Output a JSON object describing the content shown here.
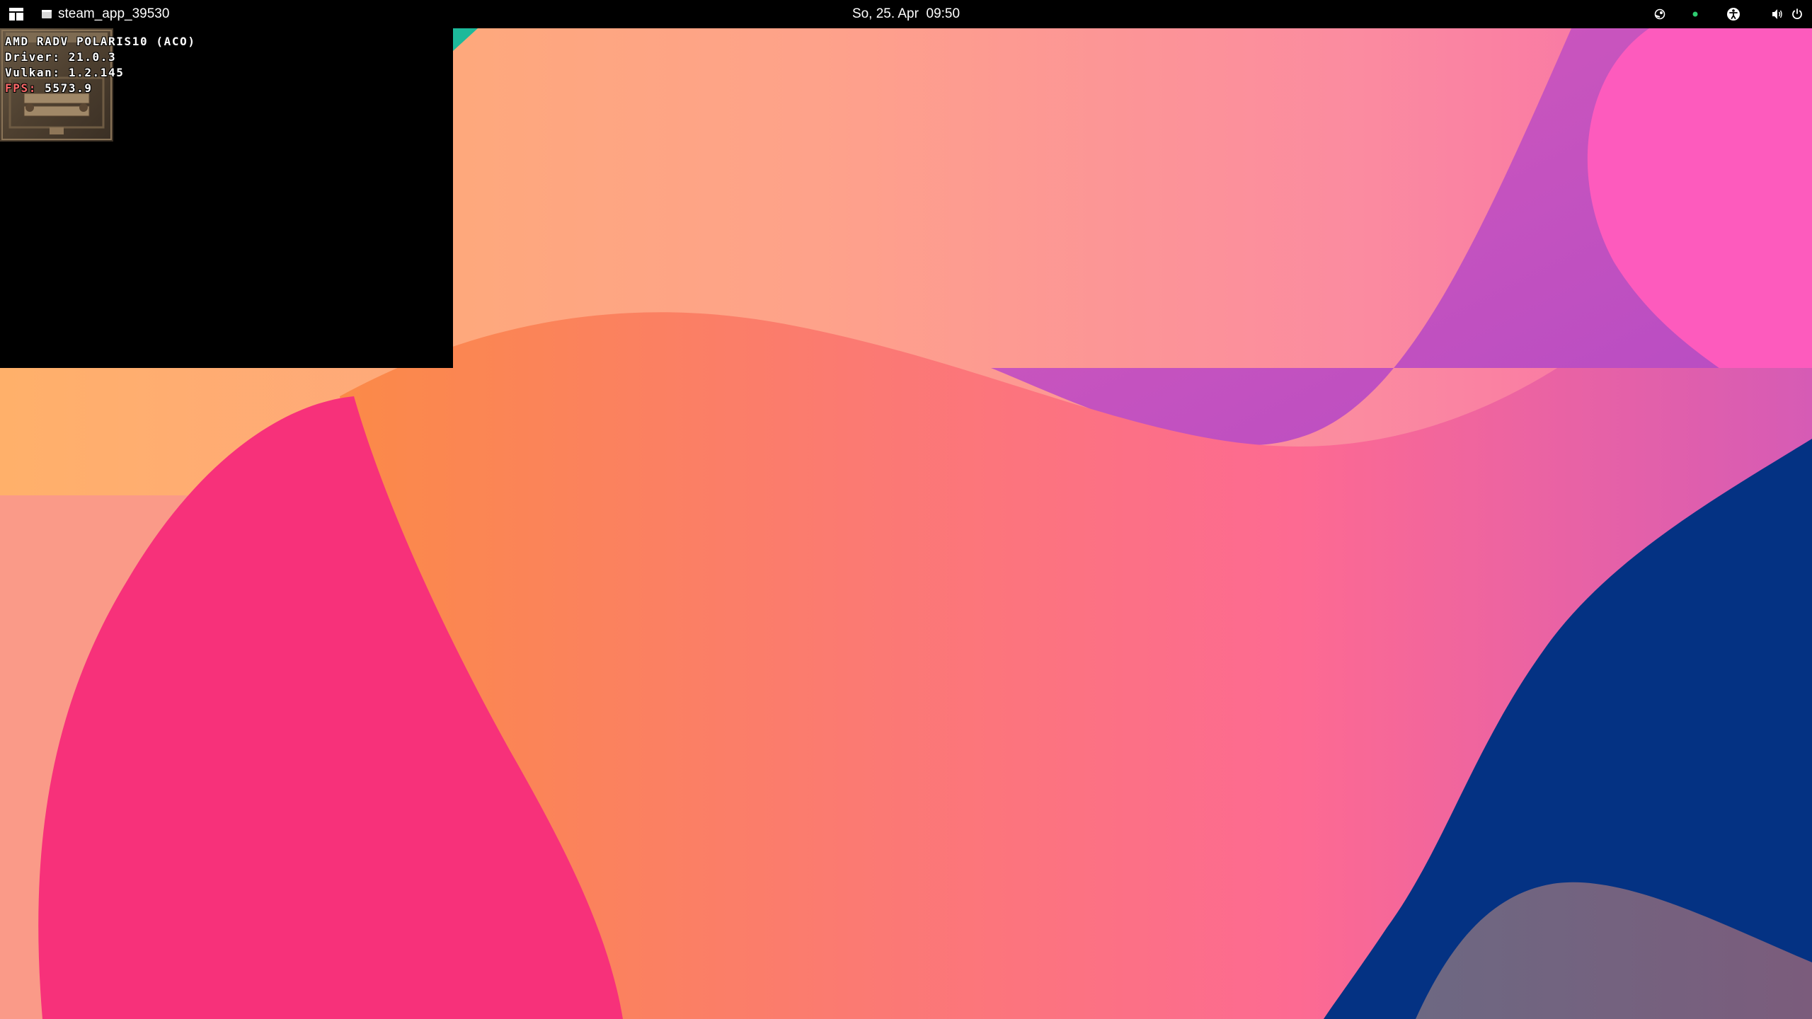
{
  "topbar": {
    "app_name": "steam_app_39530",
    "clock": "So, 25. Apr  09:50",
    "tray_icons": [
      "steam-icon",
      "status-dot-icon",
      "accessibility-icon",
      "volume-icon",
      "power-icon"
    ]
  },
  "game_window": {
    "hud": {
      "gpu": "AMD RADV POLARIS10 (ACO)",
      "driver": "Driver: 21.0.3",
      "vulkan": "Vulkan: 1.2.145",
      "fps_label": "FPS:",
      "fps_value": " 5573.9"
    }
  },
  "colors": {
    "topbar_bg": "#000000",
    "hud_fps_label": "#ff6a6a",
    "tray_dot": "#2ecc71",
    "wallpaper_pink": "#f7317a",
    "wallpaper_navy": "#043283",
    "wallpaper_teal": "#1db99a",
    "wallpaper_peach": "#fb9c86"
  }
}
